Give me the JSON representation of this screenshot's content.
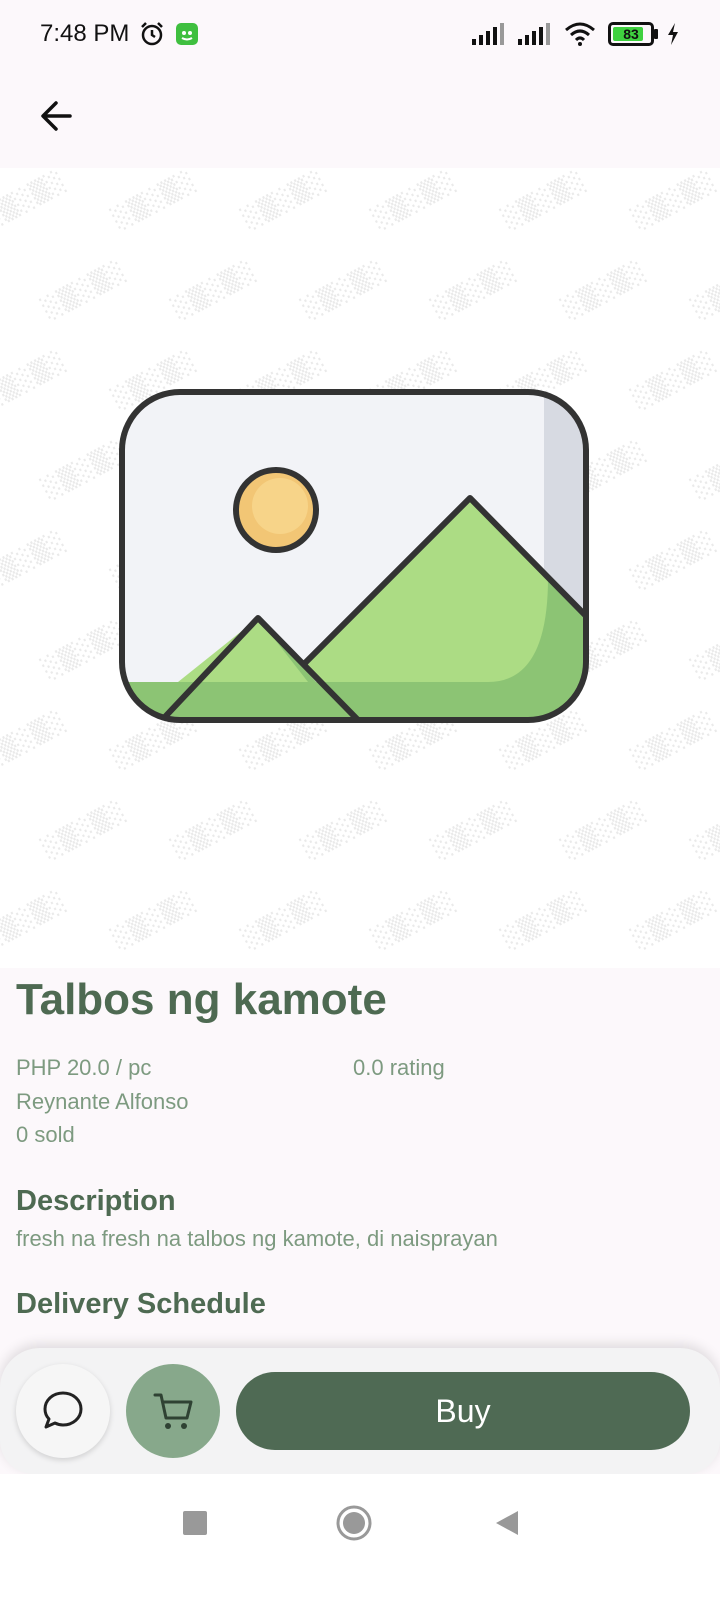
{
  "status_bar": {
    "time": "7:48 PM",
    "battery_level": 83,
    "icons": [
      "alarm-icon",
      "app-notification-icon",
      "signal-icon",
      "signal-icon",
      "wifi-icon",
      "battery-icon",
      "charging-icon"
    ]
  },
  "header": {
    "back_icon": "arrow-left-icon"
  },
  "product": {
    "image_placeholder_icon": "image-placeholder-icon",
    "name": "Talbos ng kamote",
    "price": "PHP 20.0 / pc",
    "rating": "0.0 rating",
    "seller": "Reynante Alfonso",
    "sold": "0 sold"
  },
  "description": {
    "heading": "Description",
    "text": "fresh na fresh na talbos ng kamote, di naisprayan"
  },
  "delivery": {
    "heading": "Delivery Schedule"
  },
  "actions": {
    "chat_icon": "chat-bubble-icon",
    "cart_icon": "cart-icon",
    "buy_label": "Buy"
  },
  "nav": {
    "icons": [
      "recents-square-icon",
      "home-circle-icon",
      "back-triangle-icon"
    ]
  },
  "colors": {
    "primary_dark": "#4f6a54",
    "primary_light": "#87a88b",
    "text_muted": "#7d9a80",
    "background": "#fcf8fb"
  }
}
